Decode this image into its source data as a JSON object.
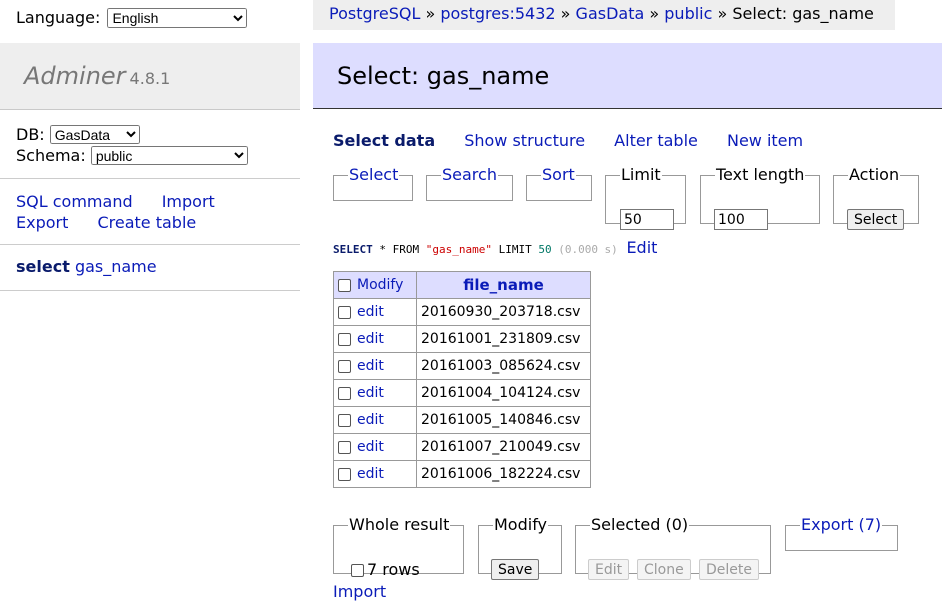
{
  "sidebar": {
    "language_label": "Language:",
    "language_value": "English",
    "app_name": "Adminer",
    "app_version": "4.8.1",
    "db_label": "DB:",
    "db_value": "GasData",
    "schema_label": "Schema:",
    "schema_value": "public",
    "links": {
      "sql_command": "SQL command",
      "import": "Import",
      "export": "Export",
      "create_table": "Create table"
    },
    "table_link_prefix": "select",
    "table_link_name": "gas_name"
  },
  "breadcrumb": {
    "server": "PostgreSQL",
    "host": "postgres:5432",
    "db": "GasData",
    "schema": "public",
    "current": "Select: gas_name",
    "sep": " » "
  },
  "page_title": "Select: gas_name",
  "subnav": {
    "select_data": "Select data",
    "show_structure": "Show structure",
    "alter_table": "Alter table",
    "new_item": "New item"
  },
  "form": {
    "select_legend": "Select",
    "search_legend": "Search",
    "sort_legend": "Sort",
    "limit_legend": "Limit",
    "limit_value": "50",
    "text_length_legend": "Text length",
    "text_length_value": "100",
    "action_legend": "Action",
    "action_button": "Select"
  },
  "query": {
    "select_kw": "SELECT",
    "mid": " * FROM ",
    "table": "\"gas_name\"",
    "limit_kw": " LIMIT ",
    "limit": "50",
    "time": " (0.000 s)",
    "edit": "Edit"
  },
  "table": {
    "header_modify": "Modify",
    "header_column": "file_name",
    "edit_label": "edit",
    "rows": [
      "20160930_203718.csv",
      "20161001_231809.csv",
      "20161003_085624.csv",
      "20161004_104124.csv",
      "20161005_140846.csv",
      "20161007_210049.csv",
      "20161006_182224.csv"
    ]
  },
  "bottom": {
    "whole_result_legend": "Whole result",
    "rows_label": "7 rows",
    "modify_legend": "Modify",
    "save_button": "Save",
    "selected_legend": "Selected (0)",
    "edit_button": "Edit",
    "clone_button": "Clone",
    "delete_button": "Delete",
    "export_legend": "Export (7)",
    "import_link": "Import"
  }
}
